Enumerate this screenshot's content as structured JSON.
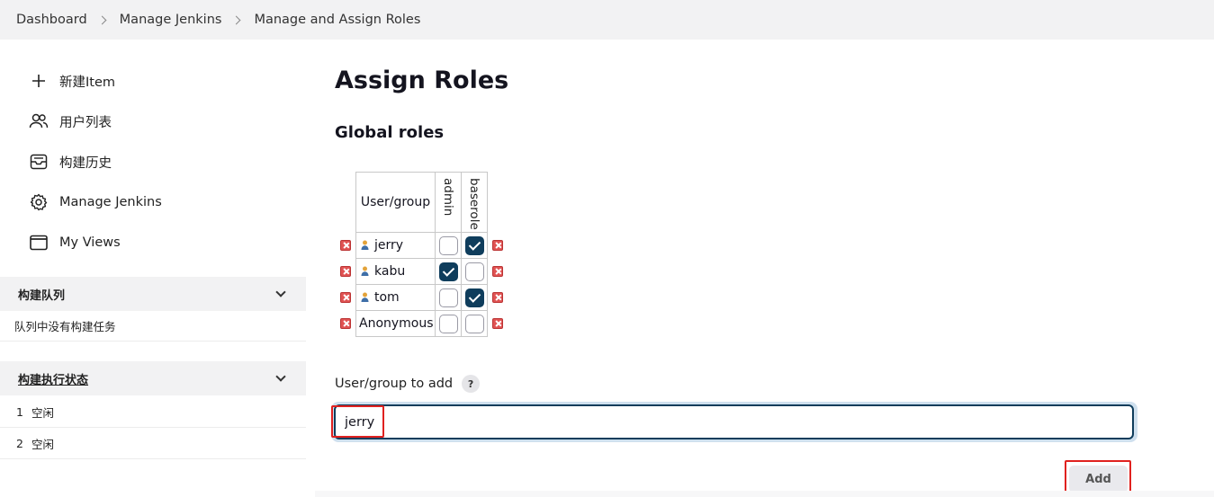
{
  "breadcrumb": [
    "Dashboard",
    "Manage Jenkins",
    "Manage and Assign Roles"
  ],
  "sidebar": {
    "items": [
      {
        "label": "新建Item",
        "icon": "plus-icon"
      },
      {
        "label": "用户列表",
        "icon": "users-icon"
      },
      {
        "label": "构建历史",
        "icon": "inbox-icon"
      },
      {
        "label": "Manage Jenkins",
        "icon": "gear-icon"
      },
      {
        "label": "My Views",
        "icon": "window-icon"
      }
    ],
    "queue": {
      "title": "构建队列",
      "empty_text": "队列中没有构建任务"
    },
    "executors": {
      "title": "构建执行状态",
      "rows": [
        {
          "num": "1",
          "status": "空闲"
        },
        {
          "num": "2",
          "status": "空闲"
        }
      ]
    }
  },
  "main": {
    "title": "Assign Roles",
    "section": "Global roles",
    "table": {
      "user_header": "User/group",
      "roles": [
        "admin",
        "baserole"
      ],
      "rows": [
        {
          "name": "jerry",
          "user_icon": true,
          "checks": [
            false,
            true
          ]
        },
        {
          "name": "kabu",
          "user_icon": true,
          "checks": [
            true,
            false
          ]
        },
        {
          "name": "tom",
          "user_icon": true,
          "checks": [
            false,
            true
          ]
        },
        {
          "name": "Anonymous",
          "user_icon": false,
          "checks": [
            false,
            false
          ]
        }
      ]
    },
    "add_label": "User/group to add",
    "help": "?",
    "input_value": "jerry",
    "add_button": "Add"
  },
  "colors": {
    "accent": "#0f3d5c",
    "highlight": "#e0211f",
    "delete": "#e05353"
  }
}
